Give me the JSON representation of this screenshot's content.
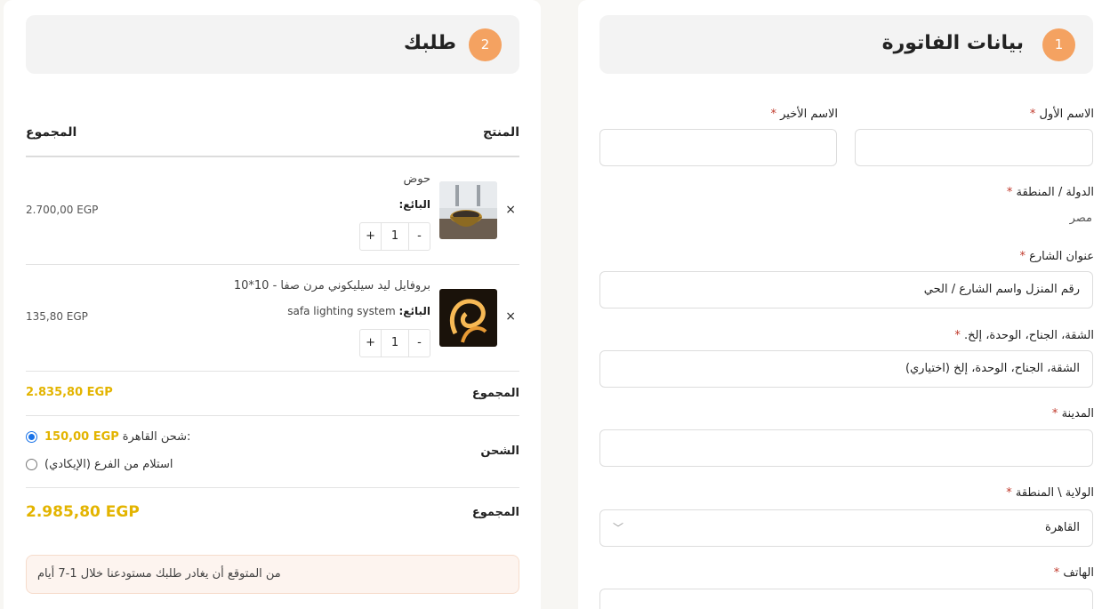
{
  "billing": {
    "step": "1",
    "title": "بيانات الفاتورة",
    "first_name": {
      "label": "الاسم الأول",
      "value": ""
    },
    "last_name": {
      "label": "الاسم الأخير",
      "value": ""
    },
    "country": {
      "label": "الدولة / المنطقة",
      "value": "مصر"
    },
    "street": {
      "label": "عنوان الشارع",
      "placeholder": "رقم المنزل واسم الشارع / الحي"
    },
    "apartment": {
      "label": "الشقة، الجناح، الوحدة، إلخ.",
      "placeholder": "الشقة، الجناح، الوحدة، إلخ (اختياري)"
    },
    "city": {
      "label": "المدينة",
      "value": ""
    },
    "state": {
      "label": "الولاية \\ المنطقة",
      "value": "القاهرة"
    },
    "phone": {
      "label": "الهاتف",
      "value": ""
    },
    "required_mark": "*"
  },
  "order": {
    "step": "2",
    "title": "طلبك",
    "col_product": "المنتج",
    "col_total": "المجموع",
    "items": [
      {
        "name": "حوض",
        "vendor_label": "البائع:",
        "vendor": "",
        "qty": "1",
        "price": "2.700,00 EGP",
        "remove": "×",
        "minus": "-",
        "plus": "+"
      },
      {
        "name": "بروفايل ليد سيليكوني مرن صفا - 10*10",
        "vendor_label": "البائع:",
        "vendor": "safa lighting system",
        "qty": "1",
        "price": "135,80 EGP",
        "remove": "×",
        "minus": "-",
        "plus": "+"
      }
    ],
    "subtotal_label": "المجموع",
    "subtotal": "2.835,80 EGP",
    "shipping_label": "الشحن",
    "shipping_options": [
      {
        "label": "شحن القاهرة:",
        "price": "150,00 EGP",
        "selected": true
      },
      {
        "label": "استلام من الفرع (الإيكادي)",
        "price": "",
        "selected": false
      }
    ],
    "total_label": "المجموع",
    "total": "2.985,80 EGP",
    "notice": "من المتوقع أن يغادر طلبك مستودعنا خلال 1-7 أيام"
  },
  "colors": {
    "accent": "#f4a261",
    "price": "#e3b400",
    "radio": "#1a73e8"
  }
}
